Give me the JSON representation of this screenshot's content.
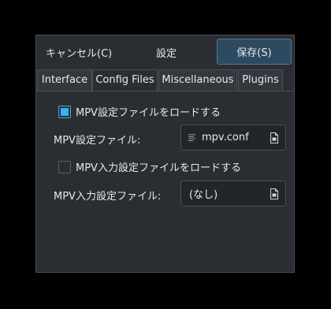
{
  "header": {
    "cancel_label": "キャンセル(C)",
    "title": "設定",
    "save_label": "保存(S)"
  },
  "tabs": [
    {
      "label": "Interface",
      "active": false
    },
    {
      "label": "Config Files",
      "active": true
    },
    {
      "label": "Miscellaneous",
      "active": false
    },
    {
      "label": "Plugins",
      "active": false
    }
  ],
  "config": {
    "load_mpv_conf": {
      "label": "MPV設定ファイルをロードする",
      "checked": true
    },
    "mpv_conf": {
      "label": "MPV設定ファイル:",
      "value": "mpv.conf"
    },
    "load_input_conf": {
      "label": "MPV入力設定ファイルをロードする",
      "checked": false
    },
    "input_conf": {
      "label": "MPV入力設定ファイル:",
      "value": "(なし)"
    }
  },
  "colors": {
    "accent": "#3daee9",
    "dialog_bg": "#2a2e32",
    "save_button_bg": "#2d4a60"
  }
}
